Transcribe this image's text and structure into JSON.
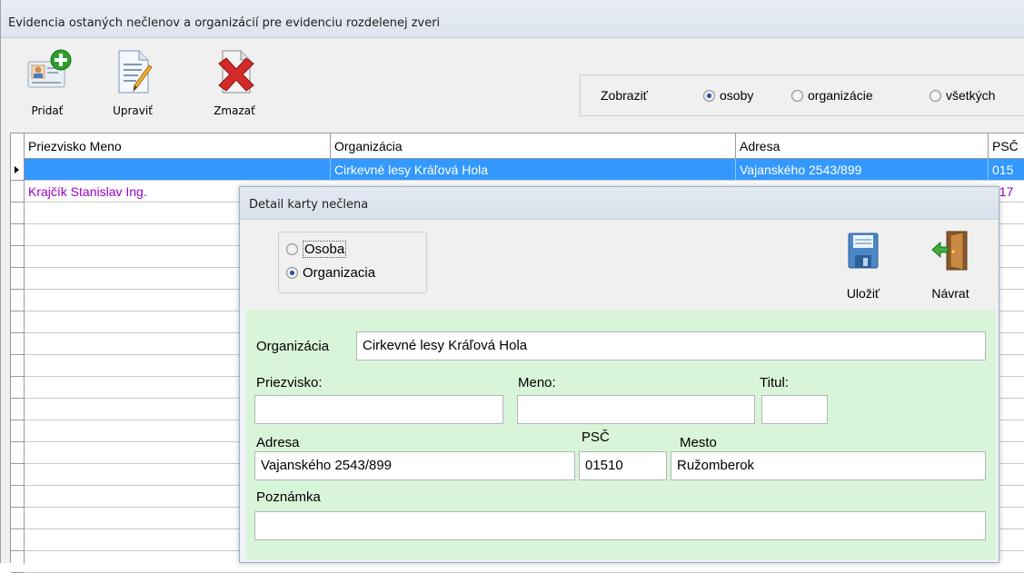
{
  "window": {
    "title": "Evidencia ostaných nečlenov a organizácií pre evidenciu rozdelenej zveri"
  },
  "toolbar": {
    "add_label": "Pridať",
    "edit_label": "Upraviť",
    "delete_label": "Zmazať",
    "add_icon": "add-person-icon",
    "edit_icon": "edit-document-icon",
    "delete_icon": "delete-document-icon"
  },
  "filter": {
    "label": "Zobraziť",
    "options": [
      "osoby",
      "organizácie",
      "všetkých"
    ],
    "selected": "osoby"
  },
  "grid": {
    "columns": [
      "Priezvisko Meno",
      "Organizácia",
      "Adresa",
      "PSČ"
    ],
    "rows": [
      {
        "name": "",
        "organization": "Cirkevné lesy Kráľová Hola",
        "address": "Vajanského 2543/899",
        "psc": "015",
        "selected": true
      },
      {
        "name": "Krajčík Stanislav Ing.",
        "organization": "",
        "address": "",
        "psc": "017",
        "selected": false
      }
    ],
    "colors": {
      "selected_row": "#3399ff",
      "highlight_text": "#9900cc"
    }
  },
  "dialog": {
    "title": "Detail karty nečlena",
    "type_options": [
      "Osoba",
      "Organizacia"
    ],
    "type_selected": "Organizacia",
    "save_label": "Uložiť",
    "back_label": "Návrat",
    "save_icon": "floppy-disk-icon",
    "back_icon": "exit-door-icon",
    "form": {
      "organization_label": "Organizácia",
      "organization_value": "Cirkevné lesy Kráľová Hola",
      "surname_label": "Priezvisko:",
      "surname_value": "",
      "name_label": "Meno:",
      "name_value": "",
      "title_label": "Titul:",
      "title_value": "",
      "address_label": "Adresa",
      "address_value": "Vajanského 2543/899",
      "psc_label": "PSČ",
      "psc_value": "01510",
      "city_label": "Mesto",
      "city_value": "Ružomberok",
      "note_label": "Poznámka",
      "note_value": ""
    },
    "colors": {
      "form_background": "#d9f5d9"
    }
  }
}
